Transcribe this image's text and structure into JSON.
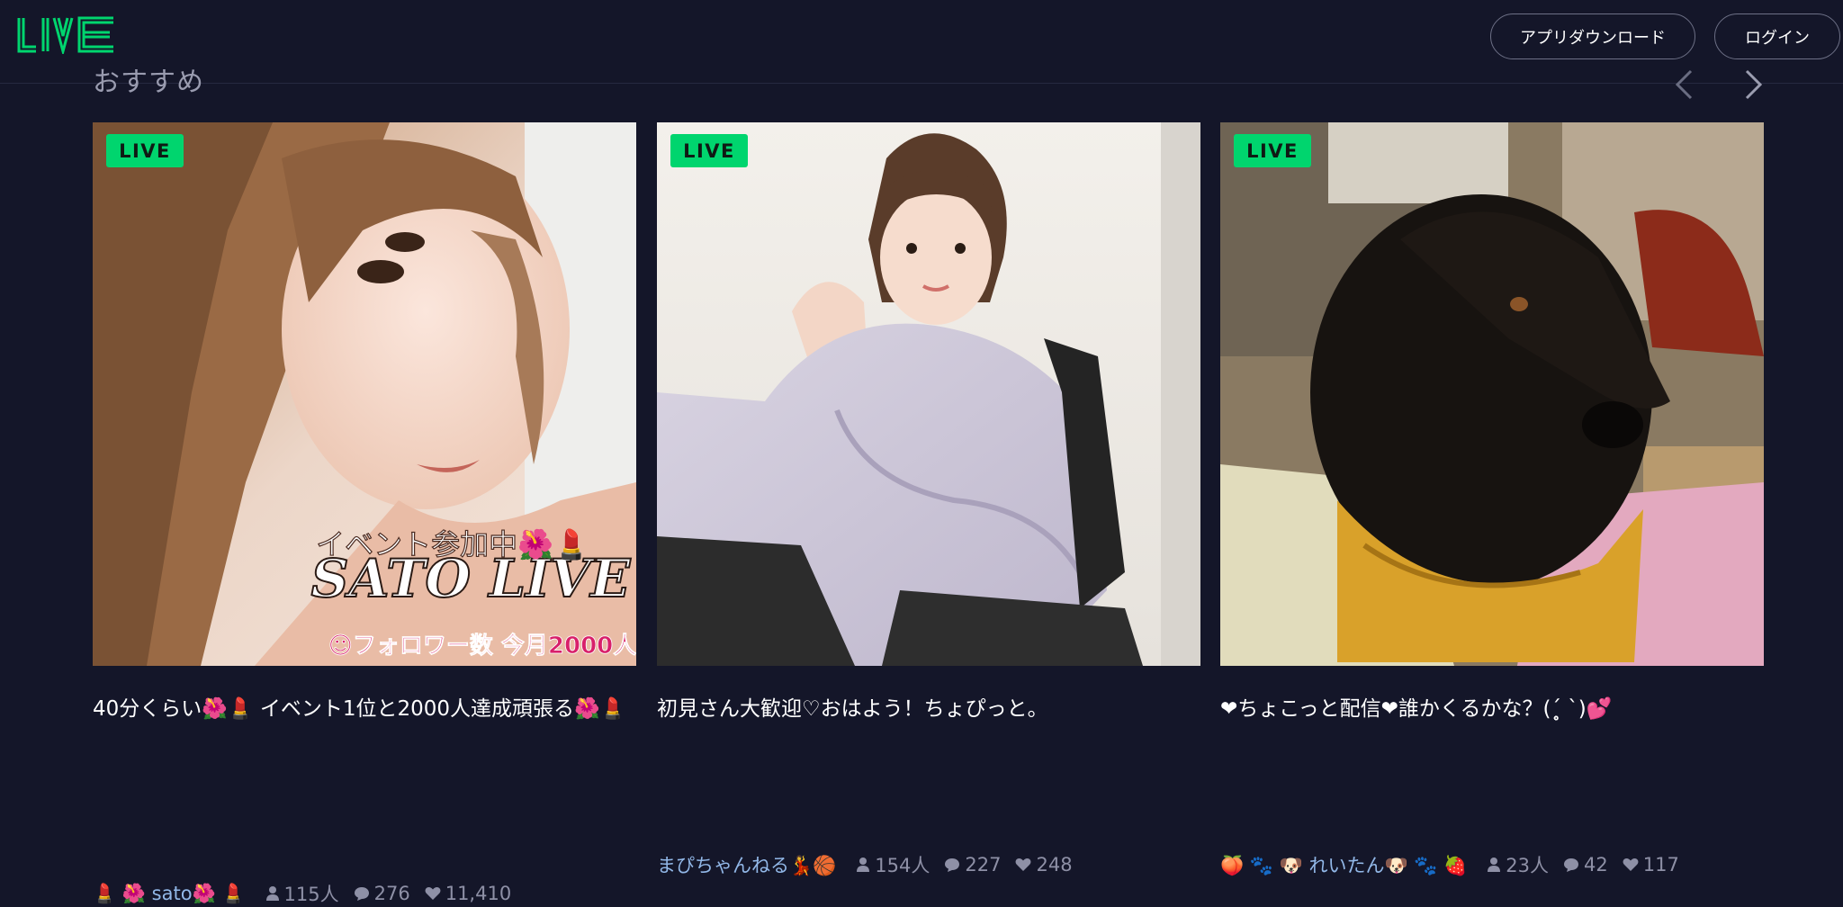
{
  "header": {
    "logo_text": "LIVE",
    "download_label": "アプリダウンロード",
    "login_label": "ログイン",
    "accent_color": "#00d56e"
  },
  "section": {
    "title": "おすすめ",
    "prev_icon": "chevron-left-icon",
    "next_icon": "chevron-right-icon"
  },
  "cards": [
    {
      "badge": "LIVE",
      "overlay_line1": "イベント参加中🌺💄",
      "overlay_line2": "SATO LIVE",
      "overlay_line3": "☺フォロワー数 今月2000人！",
      "title": "40分くらい🌺💄 イベント1位と2000人達成頑張る🌺💄",
      "user": "💄 🌺 sato🌺 💄",
      "viewers": "115人",
      "comments": "276",
      "likes": "11,410"
    },
    {
      "badge": "LIVE",
      "title": "初見さん大歓迎♡おはよう！ちょぴっと。",
      "user": "まぴちゃんねる💃🏀",
      "viewers": "154人",
      "comments": "227",
      "likes": "248"
    },
    {
      "badge": "LIVE",
      "title": "❤ちょこっと配信❤誰かくるかな？(ˊ̥̥̥̥̥ ˋ)💕",
      "user": "🍑 🐾 🐶 れいたん🐶 🐾 🍓",
      "viewers": "23人",
      "comments": "42",
      "likes": "117"
    }
  ]
}
